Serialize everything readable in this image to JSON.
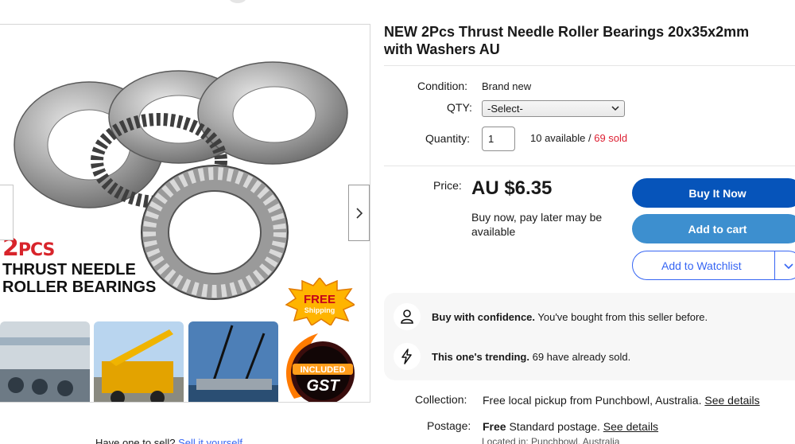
{
  "listing": {
    "title": "NEW 2Pcs Thrust Needle Roller Bearings 20x35x2mm with Washers AU"
  },
  "gallery": {
    "hero_qty_big": "2",
    "hero_qty_small": "PCS",
    "hero_line1": "THRUST NEEDLE",
    "hero_line2": "ROLLER BEARINGS",
    "free_badge_l1": "FREE",
    "free_badge_l2": "Shipping",
    "gst_badge_l1": "INCLUDED",
    "gst_badge_l2": "GST"
  },
  "details": {
    "condition_label": "Condition:",
    "condition_value": "Brand new",
    "qty_label": "QTY:",
    "qty_select": "-Select-",
    "quantity_label": "Quantity:",
    "quantity_value": "1",
    "available": "10 available / ",
    "sold": "69 sold"
  },
  "pricing": {
    "price_label": "Price:",
    "price": "AU $6.35",
    "pay_later": "Buy now, pay later may be available"
  },
  "buttons": {
    "buy_now": "Buy It Now",
    "add_to_cart": "Add to cart",
    "watchlist": "Add to Watchlist"
  },
  "confidence": {
    "item1_bold": "Buy with confidence.",
    "item1_text": " You've bought from this seller before.",
    "item2_bold": "This one's trending.",
    "item2_text": " 69 have already sold."
  },
  "shipping": {
    "collection_label": "Collection:",
    "collection_text": "Free local pickup from Punchbowl, Australia. ",
    "collection_link": "See details",
    "postage_label": "Postage:",
    "postage_bold": "Free",
    "postage_text": " Standard postage. ",
    "postage_link": "See details",
    "located": "Located in: Punchbowl, Australia"
  },
  "sell": {
    "text": "Have one to sell? ",
    "link": "Sell it yourself"
  },
  "colors": {
    "buy_now_bg": "#0654ba",
    "cart_bg": "#3d8fcf",
    "watch_border": "#3665f3",
    "sold_red": "#dd1e31"
  }
}
